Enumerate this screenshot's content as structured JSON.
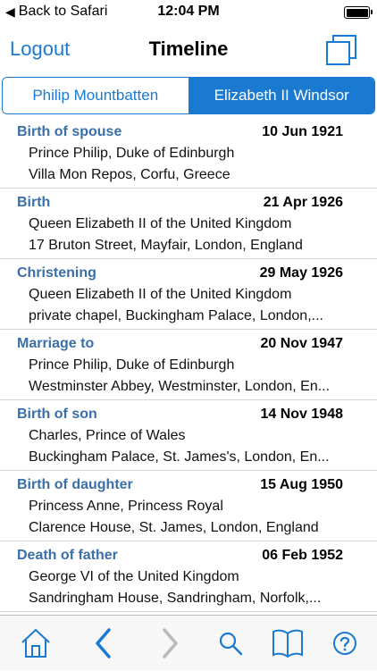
{
  "status_bar": {
    "back_label": "Back to Safari",
    "time": "12:04 PM"
  },
  "nav": {
    "left_button": "Logout",
    "title": "Timeline",
    "right_icon": "copy-icon"
  },
  "segments": {
    "left": "Philip Mountbatten",
    "right": "Elizabeth II Windsor",
    "selected": "right"
  },
  "events": [
    {
      "type": "Birth of spouse",
      "date": "10 Jun 1921",
      "person": "Prince Philip, Duke of Edinburgh",
      "place": "Villa Mon Repos, Corfu, Greece"
    },
    {
      "type": "Birth",
      "date": "21 Apr 1926",
      "person": "Queen Elizabeth II of the United Kingdom",
      "place": "17 Bruton Street, Mayfair, London, England"
    },
    {
      "type": "Christening",
      "date": "29 May 1926",
      "person": "Queen Elizabeth II of the United Kingdom",
      "place": "private chapel, Buckingham Palace, London,..."
    },
    {
      "type": "Marriage to",
      "date": "20 Nov 1947",
      "person": "Prince Philip, Duke of Edinburgh",
      "place": "Westminster Abbey, Westminster, London, En..."
    },
    {
      "type": "Birth of son",
      "date": "14 Nov 1948",
      "person": "Charles, Prince of Wales",
      "place": "Buckingham Palace, St. James's, London, En..."
    },
    {
      "type": "Birth of daughter",
      "date": "15 Aug 1950",
      "person": "Princess Anne, Princess Royal",
      "place": "Clarence House, St. James, London, England"
    },
    {
      "type": "Death of father",
      "date": "06 Feb 1952",
      "person": "George VI of the United Kingdom",
      "place": "Sandringham House, Sandringham, Norfolk,..."
    }
  ],
  "tab_bar": {
    "items": [
      "home-icon",
      "back-icon",
      "forward-icon",
      "search-icon",
      "book-icon",
      "help-icon"
    ]
  },
  "colors": {
    "accent": "#1a7ad1",
    "event_type": "#3a6fa8",
    "divider": "#d6d6d6"
  }
}
